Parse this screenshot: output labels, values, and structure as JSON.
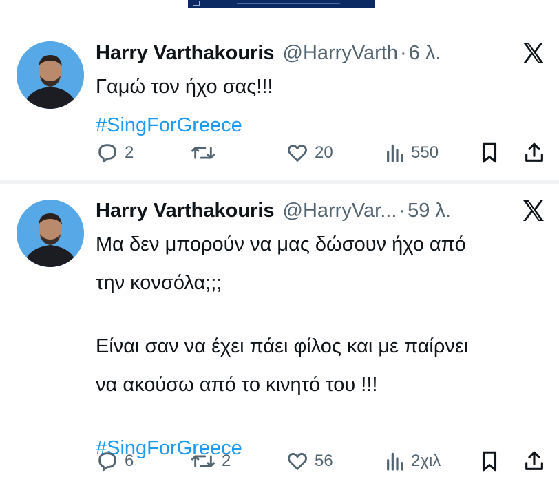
{
  "tweets": [
    {
      "name": "Harry Varthakouris",
      "handle": "@HarryVarth",
      "dot": "·",
      "time": "6 λ.",
      "lines": [
        "Γαμώ τον ήχο σας!!!"
      ],
      "hashtag": "#SingForGreece",
      "stats": {
        "replies": "2",
        "retweets": "",
        "likes": "20",
        "views": "550"
      }
    },
    {
      "name": "Harry Varthakouris",
      "handle": "@HarryVar...",
      "dot": "·",
      "time": "59 λ.",
      "lines": [
        "Μα δεν μπορούν να μας δώσουν ήχο από",
        "την κονσόλα;;;",
        "Είναι σαν να έχει πάει φίλος και με παίρνει",
        "να ακούσω από το κινητό του !!!"
      ],
      "hashtag": "#SingForGreece",
      "stats": {
        "replies": "6",
        "retweets": "2",
        "likes": "56",
        "views": "2χιλ"
      }
    }
  ],
  "icons": {
    "reply": "reply-icon",
    "retweet": "retweet-icon",
    "like": "heart-icon",
    "views": "views-icon",
    "bookmark": "bookmark-icon",
    "share": "share-icon",
    "x_logo": "x-logo-icon"
  },
  "colors": {
    "text": "#0f1419",
    "secondary": "#536471",
    "hashtag": "#1d9bf0",
    "avatar_bg": "#57a8e6"
  }
}
